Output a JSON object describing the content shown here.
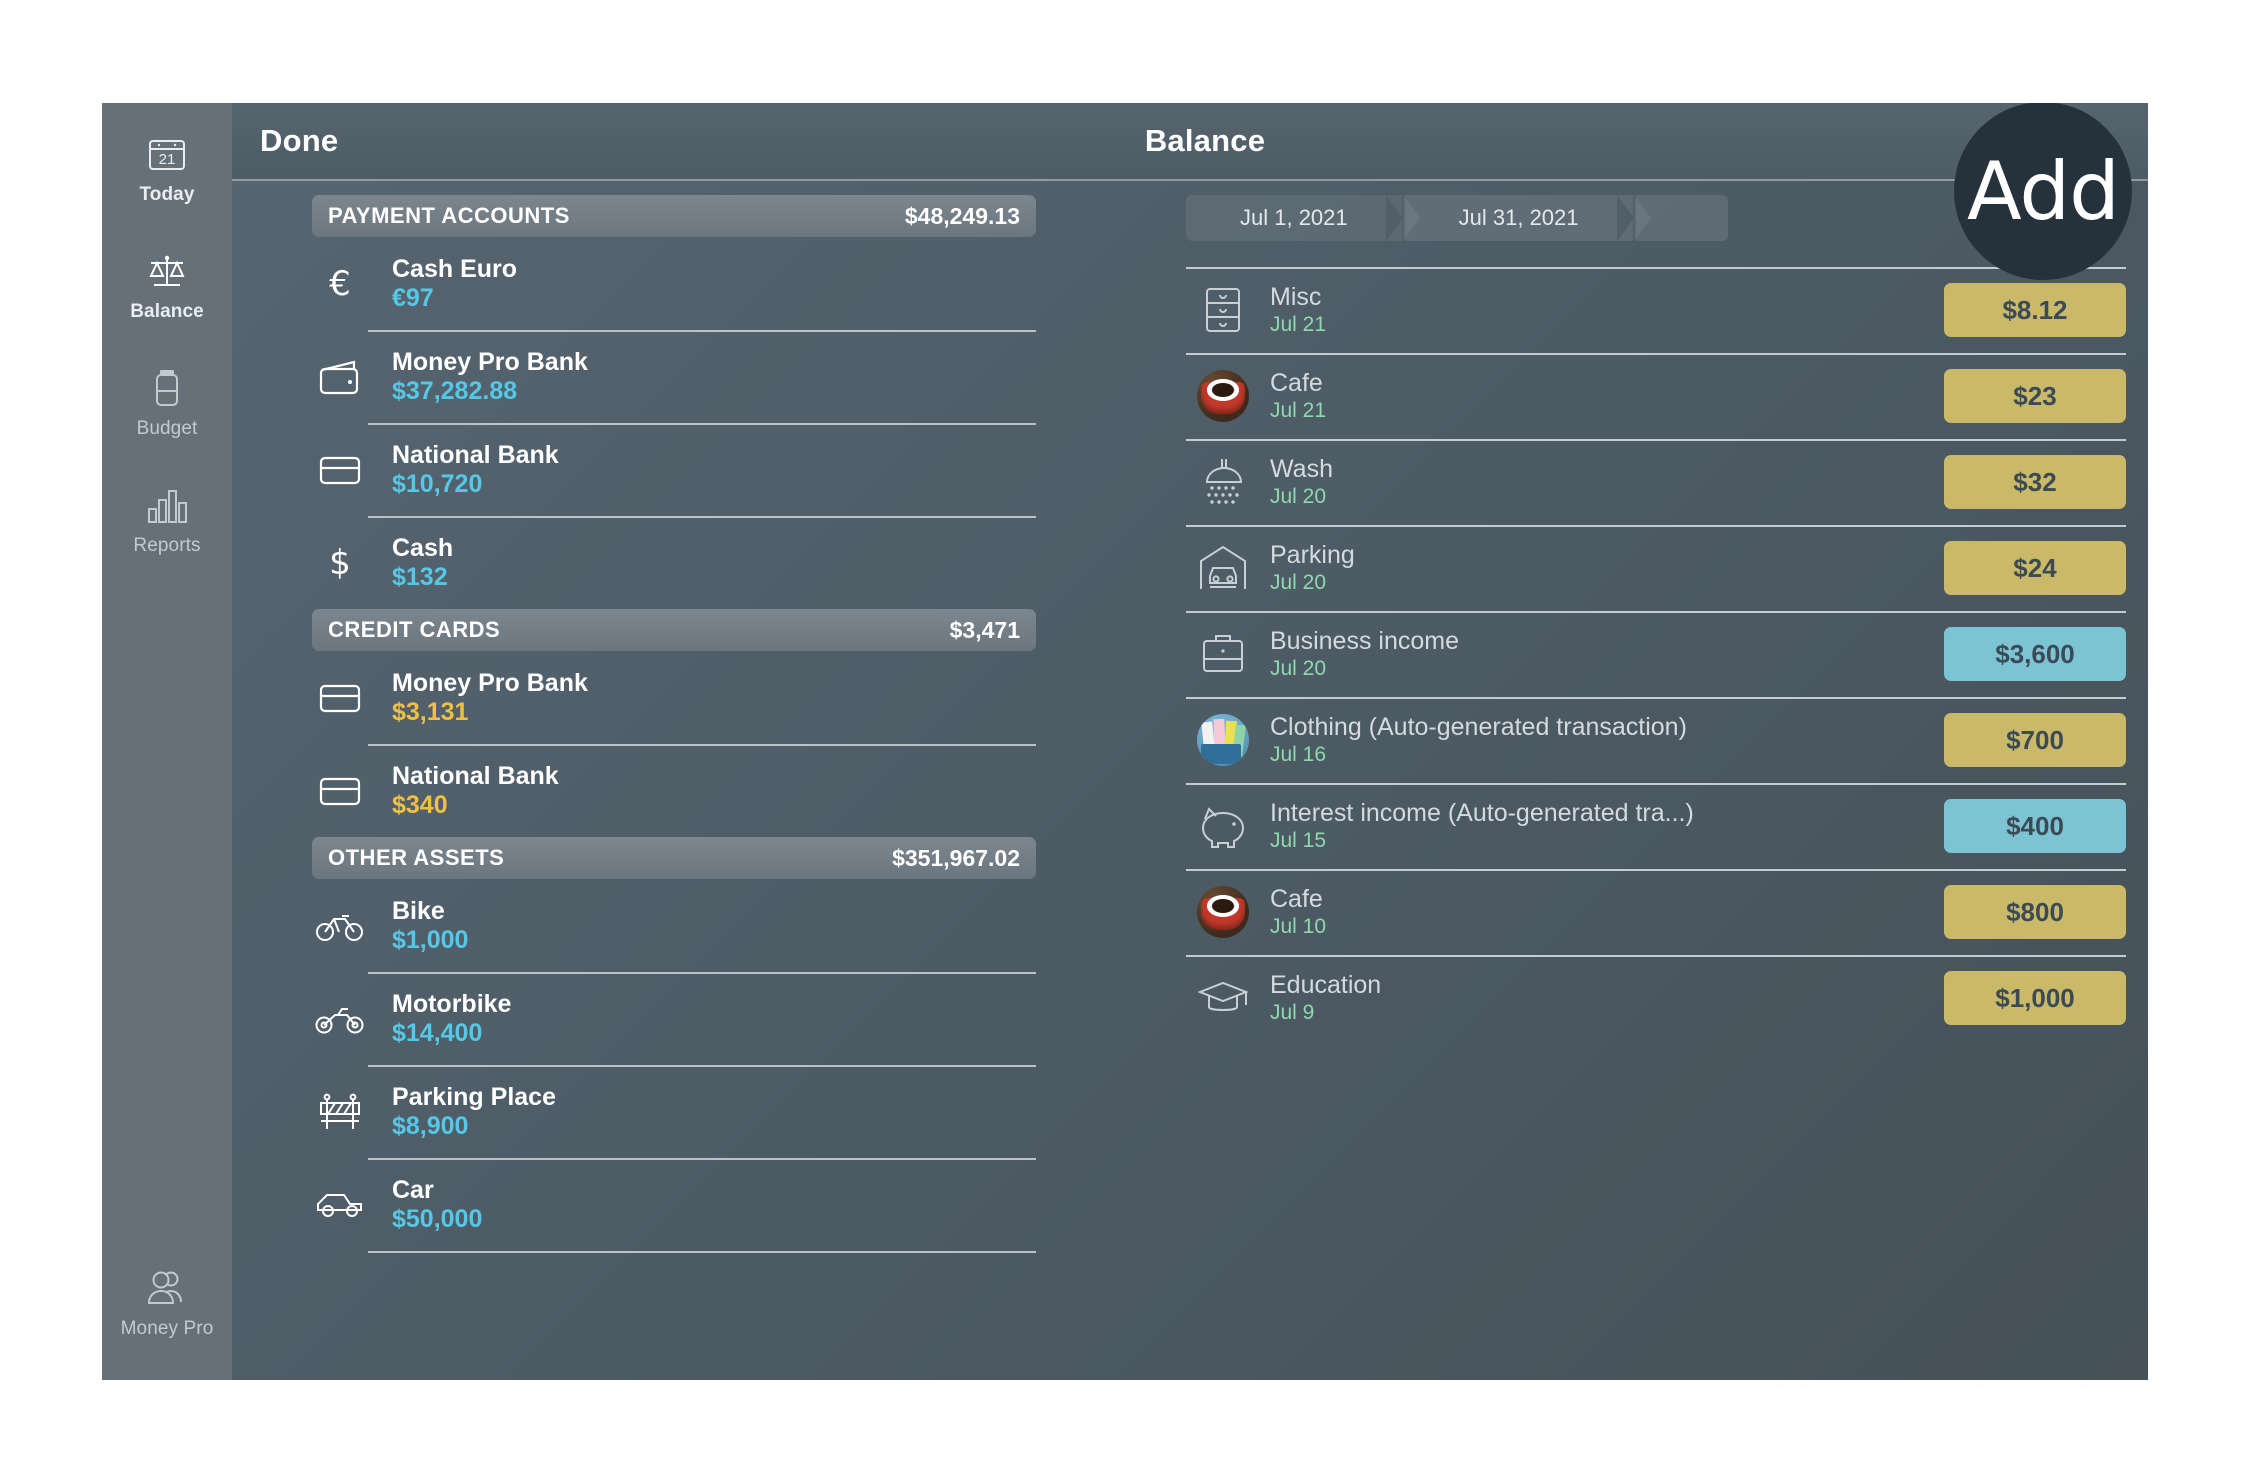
{
  "sidebar": {
    "items": [
      {
        "label": "Today",
        "icon": "calendar-21-icon",
        "day": "21"
      },
      {
        "label": "Balance",
        "icon": "scales-icon"
      },
      {
        "label": "Budget",
        "icon": "battery-icon"
      },
      {
        "label": "Reports",
        "icon": "bar-chart-icon"
      }
    ],
    "bottom": {
      "label": "Money Pro",
      "icon": "two-people-icon"
    }
  },
  "titlebar": {
    "done_label": "Done",
    "title": "Balance"
  },
  "overlay": {
    "add_label": "Add"
  },
  "accounts": {
    "sections": [
      {
        "name": "PAYMENT ACCOUNTS",
        "total": "$48,249.13",
        "rows": [
          {
            "name": "Cash Euro",
            "amount": "€97",
            "icon": "euro-symbol-icon",
            "sign": "positive"
          },
          {
            "name": "Money Pro Bank",
            "amount": "$37,282.88",
            "icon": "wallet-icon",
            "sign": "positive"
          },
          {
            "name": "National Bank",
            "amount": "$10,720",
            "icon": "credit-card-icon",
            "sign": "positive"
          },
          {
            "name": "Cash",
            "amount": "$132",
            "icon": "dollar-symbol-icon",
            "sign": "positive"
          }
        ]
      },
      {
        "name": "CREDIT CARDS",
        "total": "$3,471",
        "rows": [
          {
            "name": "Money Pro Bank",
            "amount": "$3,131",
            "icon": "credit-card-icon",
            "sign": "negative"
          },
          {
            "name": "National Bank",
            "amount": "$340",
            "icon": "credit-card-icon",
            "sign": "negative"
          }
        ]
      },
      {
        "name": "OTHER ASSETS",
        "total": "$351,967.02",
        "rows": [
          {
            "name": "Bike",
            "amount": "$1,000",
            "icon": "bicycle-icon",
            "sign": "positive"
          },
          {
            "name": "Motorbike",
            "amount": "$14,400",
            "icon": "motorbike-icon",
            "sign": "positive"
          },
          {
            "name": "Parking Place",
            "amount": "$8,900",
            "icon": "road-barrier-icon",
            "sign": "positive"
          },
          {
            "name": "Car",
            "amount": "$50,000",
            "icon": "car-icon",
            "sign": "positive"
          }
        ]
      }
    ]
  },
  "transactions": {
    "date_range": {
      "from": "Jul 1, 2021",
      "to": "Jul 31, 2021"
    },
    "rows": [
      {
        "name": "Misc",
        "date": "Jul 21",
        "amount": "$8.12",
        "type": "expense",
        "icon": "file-cabinet-icon"
      },
      {
        "name": "Cafe",
        "date": "Jul 21",
        "amount": "$23",
        "type": "expense",
        "icon": "coffee-cup-icon"
      },
      {
        "name": "Wash",
        "date": "Jul 20",
        "amount": "$32",
        "type": "expense",
        "icon": "shower-icon"
      },
      {
        "name": "Parking",
        "date": "Jul 20",
        "amount": "$24",
        "type": "expense",
        "icon": "garage-car-icon"
      },
      {
        "name": "Business income",
        "date": "Jul 20",
        "amount": "$3,600",
        "type": "income",
        "icon": "briefcase-icon"
      },
      {
        "name": "Clothing (Auto-generated transaction)",
        "date": "Jul 16",
        "amount": "$700",
        "type": "expense",
        "icon": "clothing-icon"
      },
      {
        "name": "Interest income (Auto-generated tra...)",
        "date": "Jul 15",
        "amount": "$400",
        "type": "income",
        "icon": "piggy-bank-icon"
      },
      {
        "name": "Cafe",
        "date": "Jul 10",
        "amount": "$800",
        "type": "expense",
        "icon": "coffee-cup-icon"
      },
      {
        "name": "Education",
        "date": "Jul 9",
        "amount": "$1,000",
        "type": "expense",
        "icon": "graduation-cap-icon"
      }
    ]
  },
  "colors": {
    "expense_badge": "#c9b968",
    "income_badge": "#7cc4d4",
    "positive_amount": "#55c8e8",
    "negative_amount": "#f0c040",
    "date_text": "#8fd9ae"
  }
}
